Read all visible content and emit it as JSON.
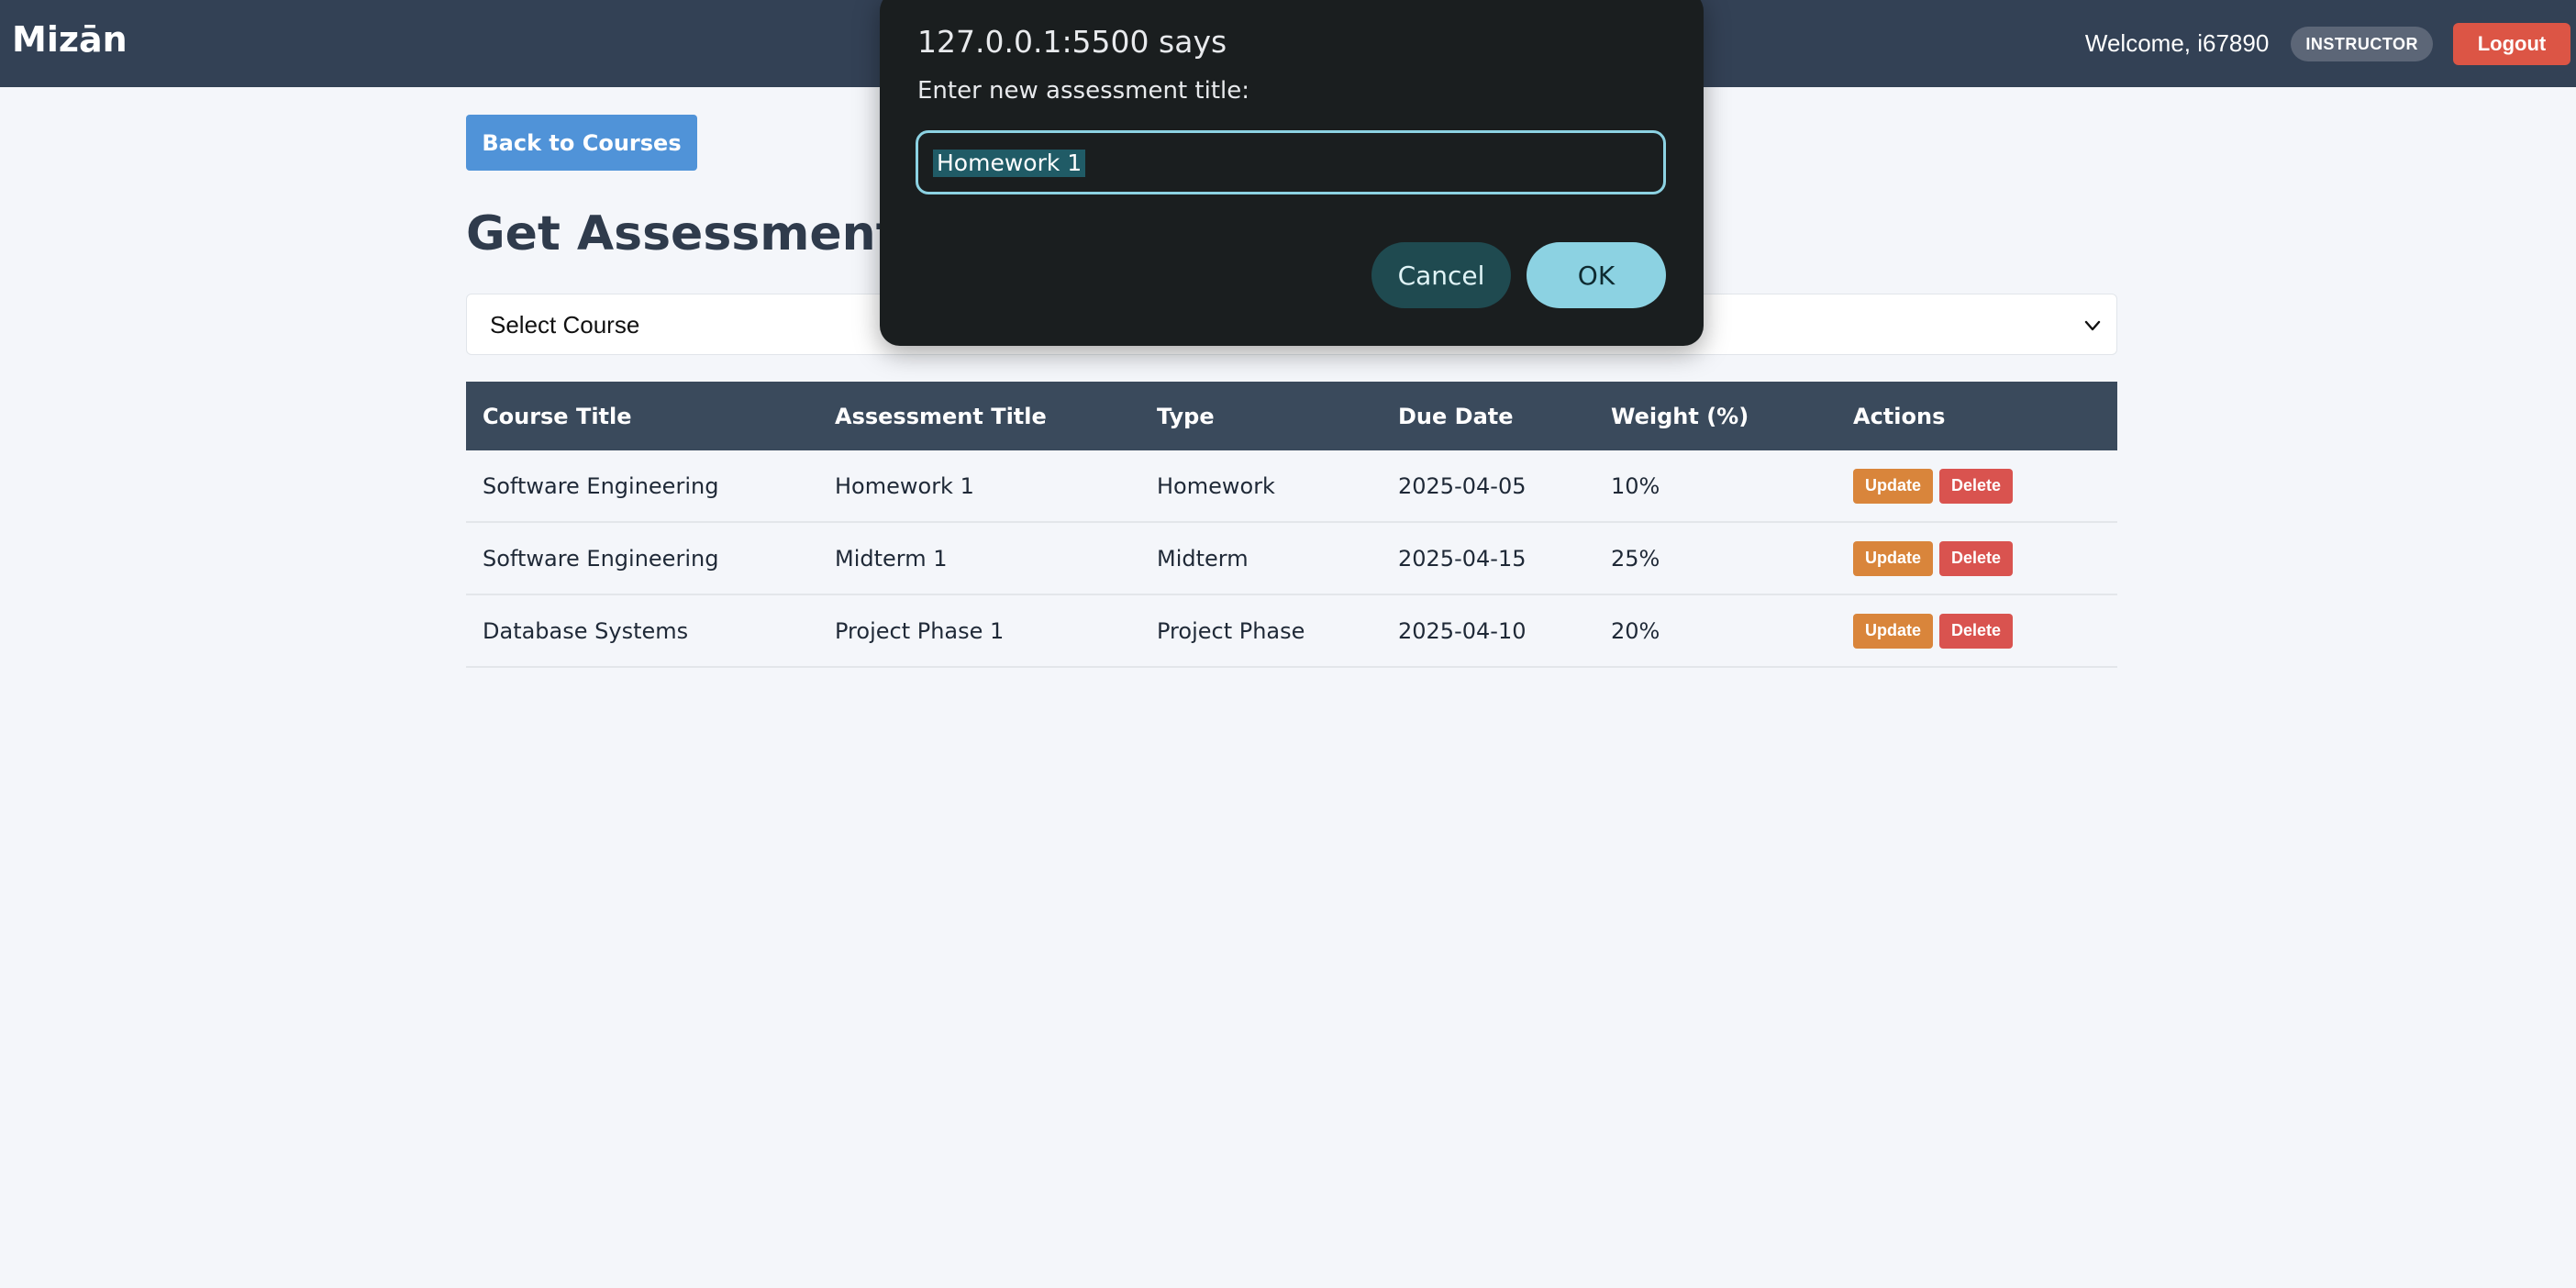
{
  "navbar": {
    "brand": "Mizān",
    "welcome": "Welcome, i67890",
    "role_badge": "INSTRUCTOR",
    "logout_label": "Logout"
  },
  "main": {
    "back_label": "Back to Courses",
    "page_title": "Get Assessments",
    "course_select": {
      "selected": "Select Course"
    },
    "table": {
      "headers": [
        "Course Title",
        "Assessment Title",
        "Type",
        "Due Date",
        "Weight (%)",
        "Actions"
      ],
      "rows": [
        {
          "course": "Software Engineering",
          "assessment": "Homework 1",
          "type": "Homework",
          "due": "2025-04-05",
          "weight": "10%"
        },
        {
          "course": "Software Engineering",
          "assessment": "Midterm 1",
          "type": "Midterm",
          "due": "2025-04-15",
          "weight": "25%"
        },
        {
          "course": "Database Systems",
          "assessment": "Project Phase 1",
          "type": "Project Phase",
          "due": "2025-04-10",
          "weight": "20%"
        }
      ],
      "update_label": "Update",
      "delete_label": "Delete"
    }
  },
  "dialog": {
    "title": "127.0.0.1:5500 says",
    "message": "Enter new assessment title:",
    "input_value": "Homework 1",
    "cancel_label": "Cancel",
    "ok_label": "OK"
  },
  "colors": {
    "navbar_bg": "#334155",
    "primary_blue": "#5093d8",
    "update_orange": "#d9853b",
    "delete_red": "#d9534f",
    "logout_red": "#dc5545",
    "table_header_bg": "#3a4a5c",
    "dialog_bg": "#1a1e1f",
    "dialog_accent": "#8cd2e2"
  }
}
